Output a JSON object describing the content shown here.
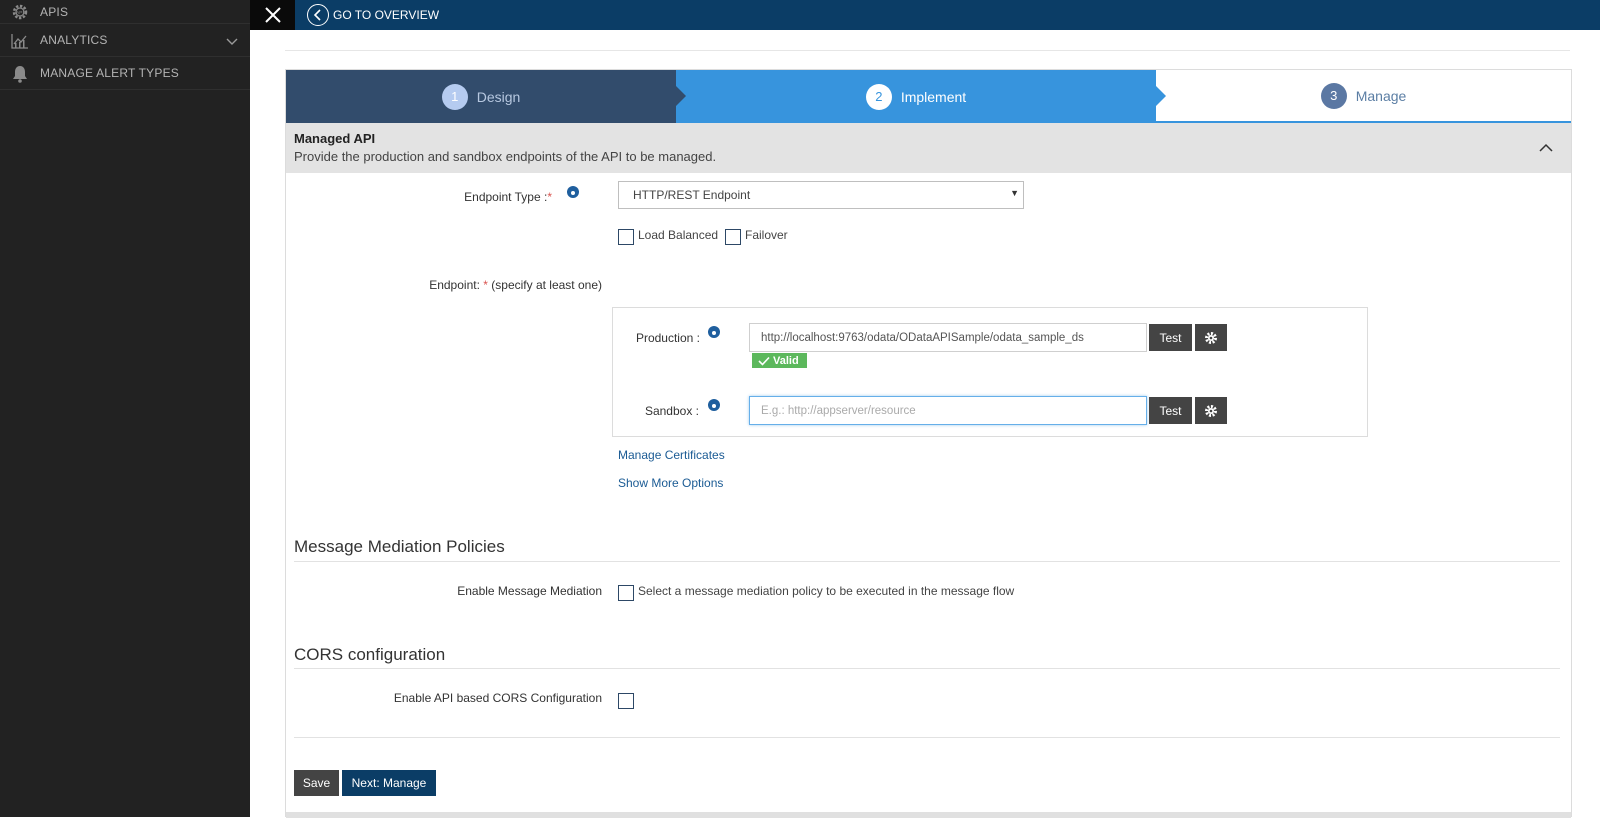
{
  "sidebar": {
    "items": [
      {
        "label": "APIS",
        "icon": "gear-icon"
      },
      {
        "label": "ANALYTICS",
        "icon": "chart-icon"
      },
      {
        "label": "MANAGE ALERT TYPES",
        "icon": "bell-icon"
      }
    ]
  },
  "topbar": {
    "go_to_overview": "GO TO OVERVIEW"
  },
  "wizard": {
    "steps": [
      {
        "num": "1",
        "label": "Design"
      },
      {
        "num": "2",
        "label": "Implement"
      },
      {
        "num": "3",
        "label": "Manage"
      }
    ]
  },
  "managed_api": {
    "title": "Managed API",
    "description": "Provide the production and sandbox endpoints of the API to be managed."
  },
  "form": {
    "endpoint_type_label": "Endpoint Type :",
    "endpoint_type_value": "HTTP/REST Endpoint",
    "load_balanced": "Load Balanced",
    "failover": "Failover",
    "endpoint_label": "Endpoint:",
    "endpoint_hint": " (specify at least one)",
    "production_label": "Production :",
    "production_value": "http://localhost:9763/odata/ODataAPISample/odata_sample_ds",
    "valid_badge": "Valid",
    "sandbox_label": "Sandbox :",
    "sandbox_placeholder": "E.g.: http://appserver/resource",
    "test_label": "Test",
    "manage_certificates": "Manage Certificates",
    "show_more_options": "Show More Options"
  },
  "mediation": {
    "title": "Message Mediation Policies",
    "enable_label": "Enable Message Mediation",
    "checkbox_text": "Select a message mediation policy to be executed in the message flow"
  },
  "cors": {
    "title": "CORS configuration",
    "enable_label": "Enable API based CORS Configuration"
  },
  "actions": {
    "save": "Save",
    "next": "Next: Manage"
  }
}
